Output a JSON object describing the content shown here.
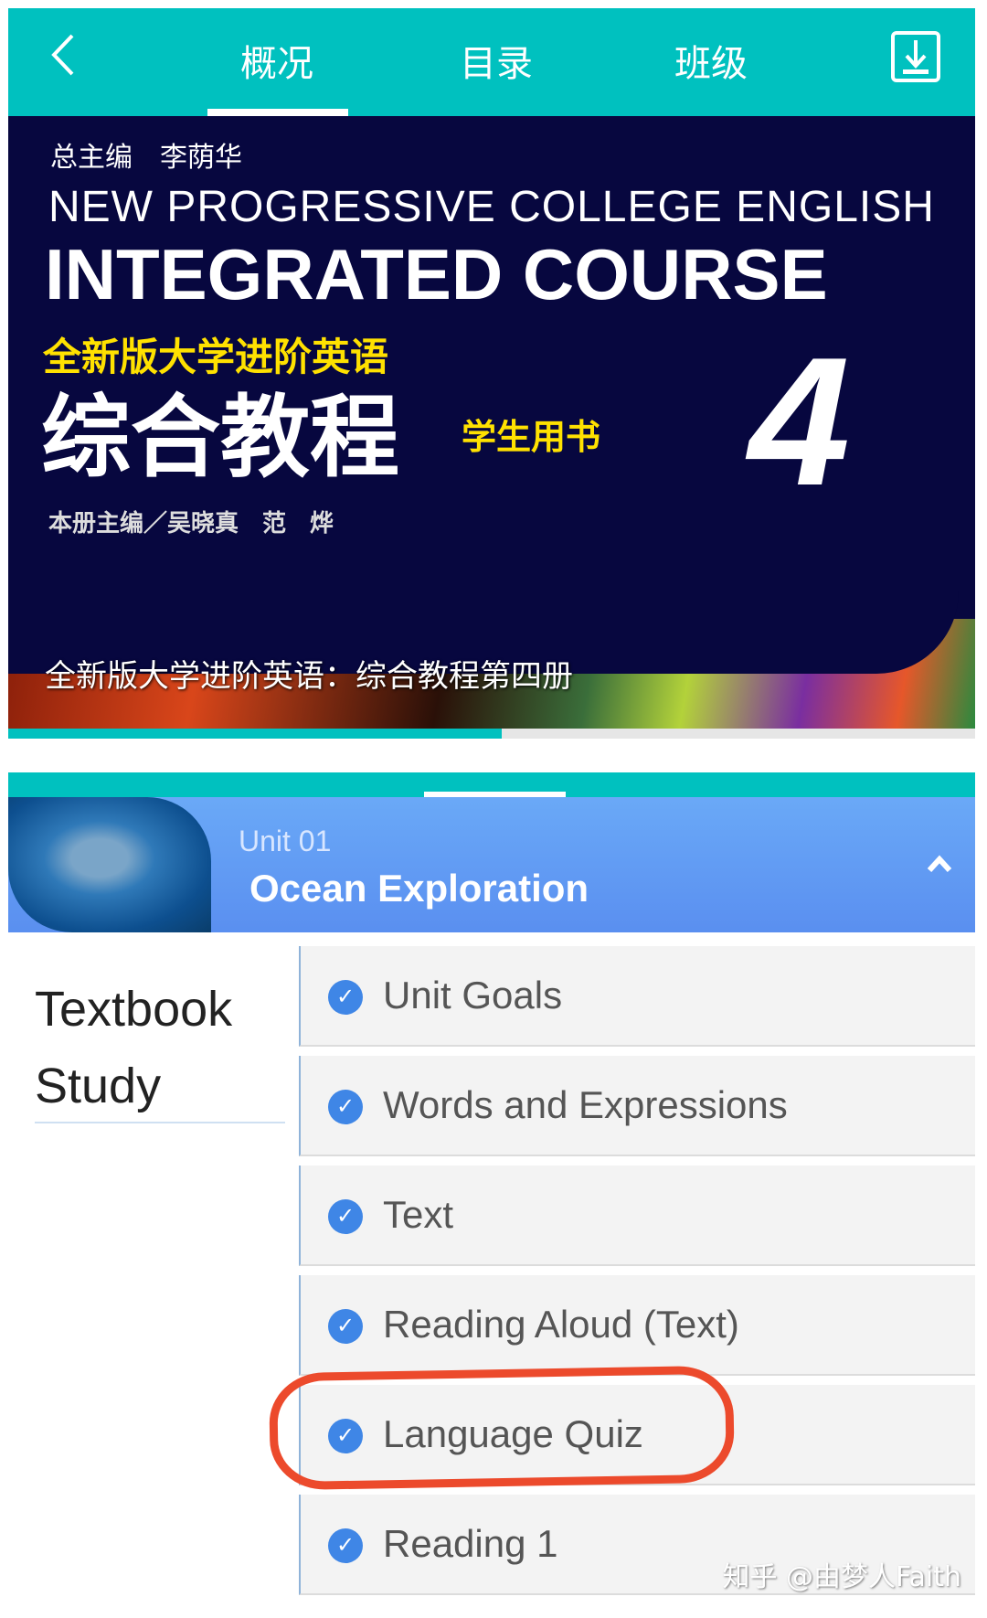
{
  "header": {
    "tabs": [
      {
        "label": "概况",
        "active": true
      },
      {
        "label": "目录"
      },
      {
        "label": "班级"
      }
    ],
    "back_icon": "chevron-left-icon",
    "download_icon": "download-icon",
    "accent": "#00c1bf"
  },
  "cover": {
    "chief_editor": "总主编　李荫华",
    "series_en": "NEW PROGRESSIVE COLLEGE ENGLISH",
    "course_en": "INTEGRATED COURSE",
    "series_cn": "全新版大学进阶英语",
    "course_cn": "综合教程",
    "book_type": "学生用书",
    "volume": "4",
    "editors": "本册主编／吴晓真　范　烨",
    "caption": "全新版大学进阶英语：综合教程第四册"
  },
  "progress": 0.51,
  "unit": {
    "number": "Unit 01",
    "title": "Ocean Exploration",
    "toggle_icon": "chevron-up-icon"
  },
  "section": {
    "title_line1": "Textbook",
    "title_line2": "Study"
  },
  "items": [
    {
      "label": "Unit Goals"
    },
    {
      "label": "Words and Expressions"
    },
    {
      "label": "Text"
    },
    {
      "label": "Reading Aloud (Text)"
    },
    {
      "label": "Language Quiz",
      "highlighted": true
    },
    {
      "label": "Reading 1"
    }
  ],
  "watermark": "知乎 @由梦人Faith"
}
